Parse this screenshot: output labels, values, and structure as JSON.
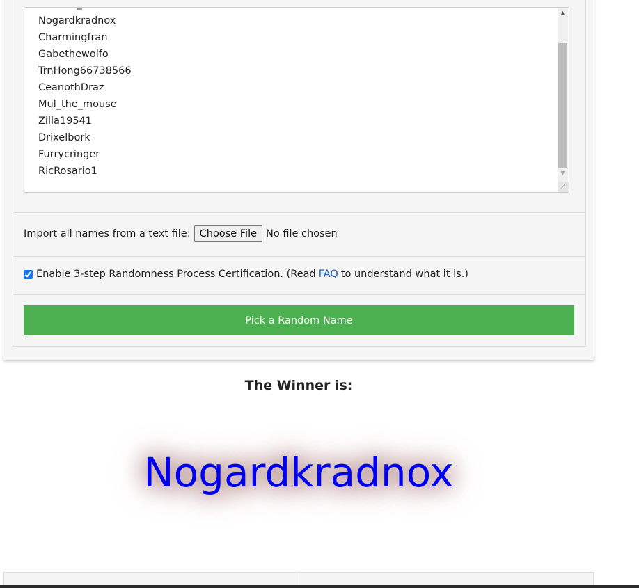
{
  "names_list": [
    "Michael_kuouno",
    "Nogardkradnox",
    "Charmingfran",
    "Gabethewolfo",
    "TrnHong66738566",
    "CeanothDraz",
    "Mul_the_mouse",
    "Zilla19541",
    "Drixelbork",
    "Furrycringer",
    "RicRosario1"
  ],
  "import": {
    "label": "Import all names from a text file:",
    "button": "Choose File",
    "status": "No file chosen"
  },
  "certification": {
    "checked": true,
    "text_before": "Enable 3-step Randomness Process Certification. (Read",
    "link": "FAQ",
    "text_after": "to understand what it is.)"
  },
  "pick_button": "Pick a Random Name",
  "winner": {
    "label": "The Winner is:",
    "name": "Nogardkradnox"
  },
  "colors": {
    "button": "#4caf50",
    "winner_text": "#0000ee",
    "link": "#1a5ec0"
  }
}
